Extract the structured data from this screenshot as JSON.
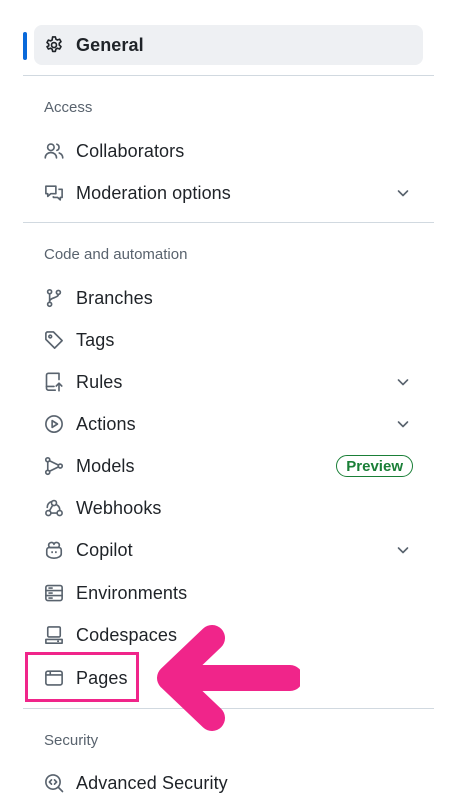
{
  "sidebar": {
    "general": {
      "label": "General",
      "icon": "gear-icon"
    },
    "sections": [
      {
        "title": "Access",
        "items": [
          {
            "label": "Collaborators",
            "icon": "people-icon",
            "expandable": false
          },
          {
            "label": "Moderation options",
            "icon": "comment-discussion-icon",
            "expandable": true
          }
        ]
      },
      {
        "title": "Code and automation",
        "items": [
          {
            "label": "Branches",
            "icon": "git-branch-icon",
            "expandable": false
          },
          {
            "label": "Tags",
            "icon": "tag-icon",
            "expandable": false
          },
          {
            "label": "Rules",
            "icon": "repo-push-icon",
            "expandable": true
          },
          {
            "label": "Actions",
            "icon": "play-icon",
            "expandable": true
          },
          {
            "label": "Models",
            "icon": "ai-model-icon",
            "expandable": false,
            "badge": "Preview"
          },
          {
            "label": "Webhooks",
            "icon": "webhook-icon",
            "expandable": false
          },
          {
            "label": "Copilot",
            "icon": "copilot-icon",
            "expandable": true
          },
          {
            "label": "Environments",
            "icon": "server-icon",
            "expandable": false
          },
          {
            "label": "Codespaces",
            "icon": "codespaces-icon",
            "expandable": false
          },
          {
            "label": "Pages",
            "icon": "browser-icon",
            "expandable": false,
            "highlighted": true
          }
        ]
      },
      {
        "title": "Security",
        "items": [
          {
            "label": "Advanced Security",
            "icon": "codescan-icon",
            "expandable": false
          }
        ]
      }
    ]
  },
  "colors": {
    "active_indicator": "#0969da",
    "active_background": "#eef0f3",
    "badge_green": "#1a7f37",
    "annotation_pink": "#f0258a",
    "divider": "#d1d9e0",
    "muted_text": "#59636e"
  }
}
